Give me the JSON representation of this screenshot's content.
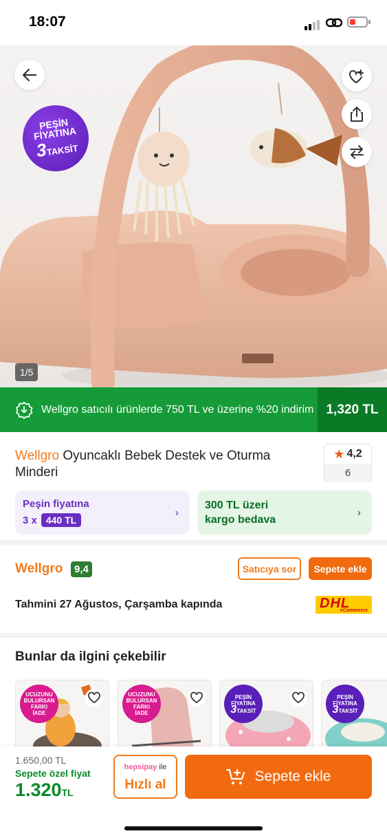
{
  "status_bar": {
    "time": "18:07"
  },
  "hero": {
    "image_counter": "1/5",
    "promo_badge": {
      "line1": "PEŞİN",
      "line2": "FİYATINA",
      "line3_num": "3",
      "line3_text": "TAKSİT"
    },
    "icons": [
      "back-arrow-icon",
      "heart-list-icon",
      "share-icon",
      "compare-icon"
    ]
  },
  "campaign": {
    "text": "Wellgro satıcılı ürünlerde 750 TL ve üzerine %20 indirim",
    "price": "1,320 TL"
  },
  "product": {
    "brand": "Wellgro",
    "name": "Oyuncaklı Bebek Destek ve Oturma Minderi",
    "rating": "4,2",
    "review_count": "6"
  },
  "installment_card": {
    "line1": "Peşin fiyatına",
    "prefix": "3 x",
    "amount": "440 TL"
  },
  "shipping_card": {
    "line1": "300 TL üzeri",
    "line2": "kargo bedava"
  },
  "seller": {
    "name": "Wellgro",
    "score": "9,4",
    "ask_label": "Satıcıya sor",
    "add_label": "Sepete ekle"
  },
  "delivery": {
    "text": "Tahmini 27 Ağustos, Çarşamba kapında",
    "carrier": "DHL",
    "carrier_sub": "eCommerce"
  },
  "recommendations": {
    "title": "Bunlar da ilgini çekebilir",
    "items": [
      {
        "badge": [
          "UCUZUNU",
          "BULURSAN",
          "FARKI",
          "İADE"
        ]
      },
      {
        "badge": [
          "UCUZUNU",
          "BULURSAN",
          "FARKI",
          "İADE"
        ]
      },
      {
        "badge": [
          "PEŞİN",
          "FİYATINA",
          "3",
          "TAKSİT"
        ]
      },
      {
        "badge": [
          "PEŞİN",
          "FİYATINA",
          "3",
          "TAKSİT"
        ]
      }
    ]
  },
  "bottom_bar": {
    "old_price": "1.650,00 TL",
    "special_label": "Sepete özel fiyat",
    "special_price": "1.320",
    "currency": "TL",
    "quick_buy_brand": "hepsipay",
    "quick_buy_with": "ile",
    "quick_buy_label": "Hızlı al",
    "add_to_cart": "Sepete ekle"
  },
  "colors": {
    "brand_orange": "#f27a1a",
    "campaign_green": "#159b37",
    "installment_purple": "#6a2ec3"
  }
}
